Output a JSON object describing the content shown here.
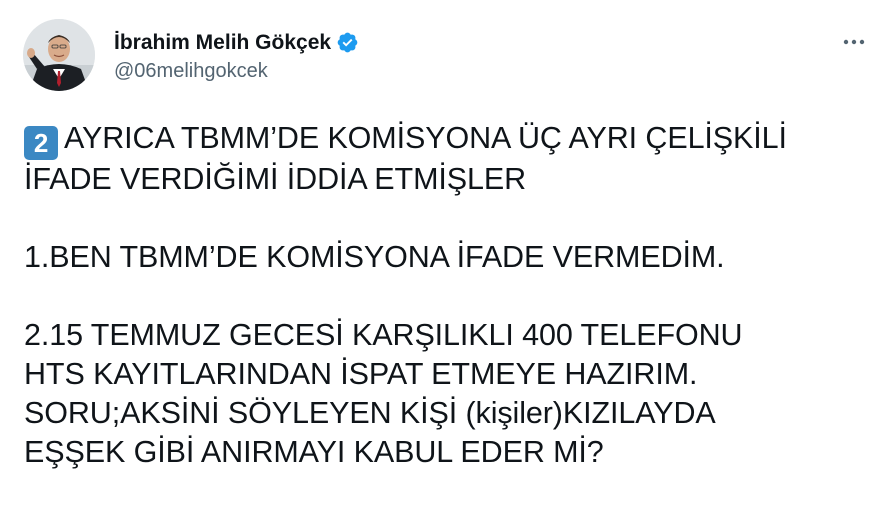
{
  "author": {
    "display_name": "İbrahim Melih Gökçek",
    "handle": "@06melihgokcek",
    "verified": true,
    "avatar_icon": "profile-photo",
    "verified_icon": "verified-badge-icon",
    "verified_color": "#1d9bf0"
  },
  "menu": {
    "icon": "more-options-icon"
  },
  "tweet": {
    "emoji_keycap": "2",
    "emoji_keycap_color": "#3b88c3",
    "para1_line1": "AYRICA TBMM’DE KOMİSYONA ÜÇ AYRI ÇELİŞKİLİ",
    "para1_line2": "İFADE VERDİĞİMİ İDDİA ETMİŞLER",
    "para2_line1": "1.BEN TBMM’DE KOMİSYONA İFADE VERMEDİM.",
    "para3_line1": "2.15 TEMMUZ GECESİ KARŞILIKLI 400 TELEFONU",
    "para3_line2": "HTS KAYITLARINDAN İSPAT ETMEYE HAZIRIM.",
    "para3_line3": "SORU;AKSİNİ SÖYLEYEN KİŞİ (kişiler)KIZILAYDA",
    "para3_line4": "EŞŞEK GİBİ ANIRMAYI KABUL EDER Mİ?"
  }
}
